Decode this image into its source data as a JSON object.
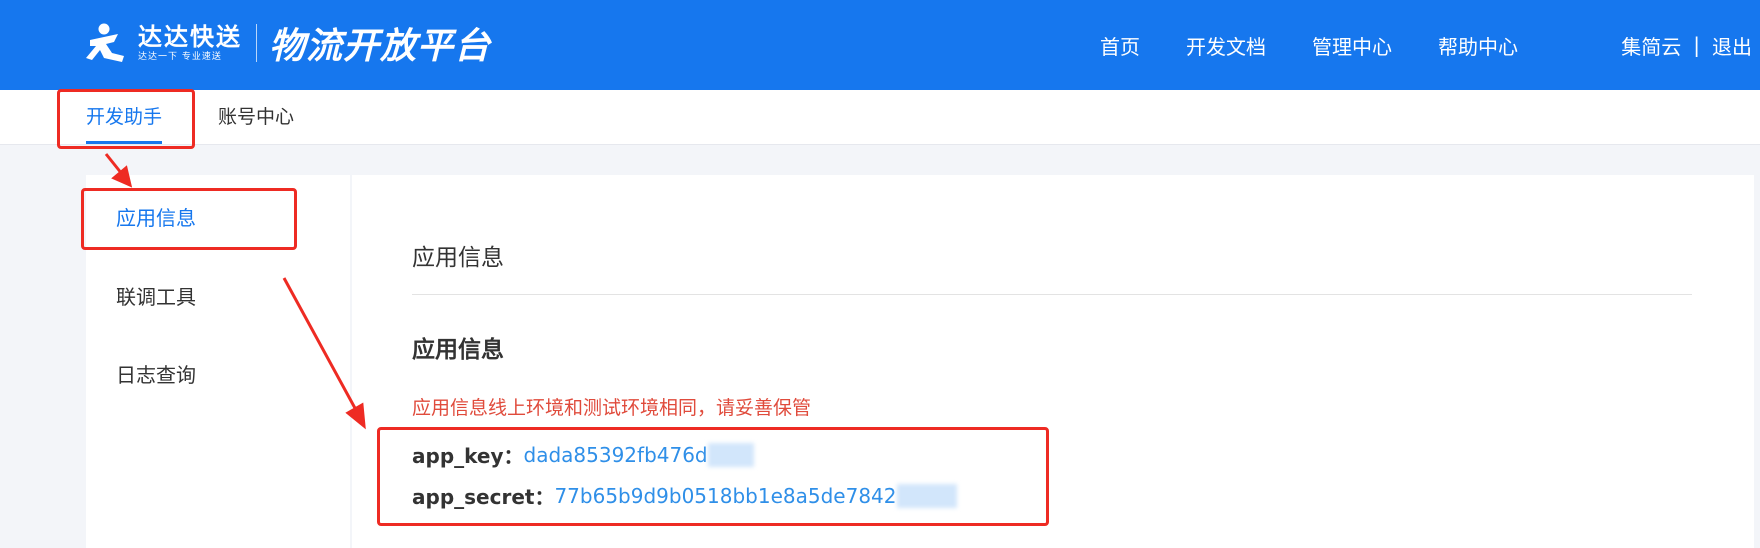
{
  "brand": {
    "name": "达达快送",
    "slogan": "达达一下 专业速送",
    "platform": "物流开放平台"
  },
  "nav": {
    "items": [
      "首页",
      "开发文档",
      "管理中心",
      "帮助中心"
    ]
  },
  "user": {
    "name": "集简云",
    "separator": "|",
    "logout": "退出"
  },
  "subtabs": {
    "active": "开发助手",
    "account": "账号中心"
  },
  "sidebar": {
    "items": [
      "应用信息",
      "联调工具",
      "日志查询"
    ]
  },
  "main": {
    "panel_title": "应用信息",
    "section_title": "应用信息",
    "notice": "应用信息线上环境和测试环境相同，请妥善保管",
    "app_key_label": "app_key：",
    "app_key_value": "dada85392fb476d",
    "app_secret_label": "app_secret：",
    "app_secret_value": "77b65b9d9b0518bb1e8a5de7842"
  },
  "colors": {
    "brand_blue": "#1677ee",
    "link_blue": "#2f8fe8",
    "notice_red": "#e04b3c",
    "annotation_red": "#ee2b23"
  }
}
